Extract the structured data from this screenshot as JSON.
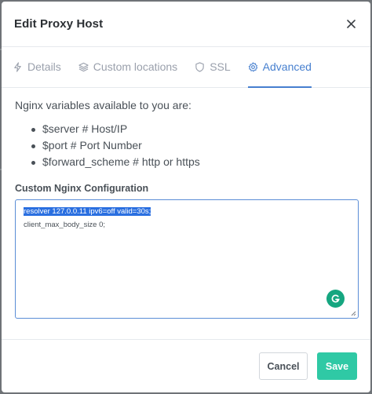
{
  "modal": {
    "title": "Edit Proxy Host"
  },
  "tabs": [
    {
      "label": "Details",
      "icon": "bolt-icon",
      "active": false
    },
    {
      "label": "Custom locations",
      "icon": "layers-icon",
      "active": false
    },
    {
      "label": "SSL",
      "icon": "shield-icon",
      "active": false
    },
    {
      "label": "Advanced",
      "icon": "gear-icon",
      "active": true
    }
  ],
  "advanced": {
    "intro": "Nginx variables available to you are:",
    "variables": [
      "$server # Host/IP",
      "$port # Port Number",
      "$forward_scheme # http or https"
    ],
    "config_label": "Custom Nginx Configuration",
    "config_lines": [
      "resolver 127.0.0.11 ipv6=off valid=30s;",
      "client_max_body_size 0;"
    ]
  },
  "footer": {
    "cancel_label": "Cancel",
    "save_label": "Save"
  },
  "colors": {
    "accent": "#467fcf",
    "save": "#2fc9a5",
    "grammarly": "#15a680",
    "selection": "#2a6fe0"
  }
}
